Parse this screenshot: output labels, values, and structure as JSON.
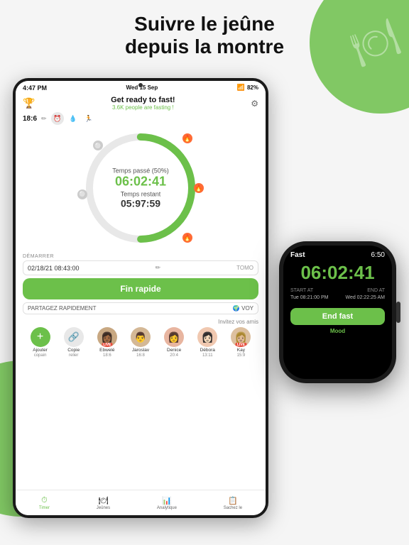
{
  "header": {
    "line1": "Suivre le jeûne",
    "line2": "depuis la montre"
  },
  "tablet": {
    "statusBar": {
      "time": "4:47 PM",
      "date": "Wed 15 Sep",
      "battery": "82%",
      "signal": "▲▼"
    },
    "appHeader": {
      "title": "Get ready to fast!",
      "subtitle": "3.6K people are fasting !",
      "trophy": "🏆",
      "gear": "⚙"
    },
    "fastSelector": {
      "label": "18:6",
      "edit": "✏",
      "icons": [
        "⏰",
        "💧",
        "🏃"
      ]
    },
    "timer": {
      "percentLabel": "Temps passé (50%)",
      "elapsedValue": "06:02:41",
      "remainingLabel": "Temps restant",
      "remainingValue": "05:97:59"
    },
    "startSection": {
      "label": "DÉMARRER",
      "dateValue": "02/18/21 08:43:00",
      "editIcon": "✏",
      "tomoLabel": "TOMO"
    },
    "finRapideBtn": "Fin rapide",
    "partagerRow": {
      "label": "PARTAGEZ RAPIDEMENT",
      "suffix": "🌍 VOY"
    },
    "friends": {
      "inviteLabel": "Invitez vos amis",
      "items": [
        {
          "name": "Ajouter copain",
          "avatar": "+",
          "time": "",
          "isAdd": true
        },
        {
          "name": "Copie relier",
          "avatar": "🔗",
          "time": "",
          "isLink": true
        },
        {
          "name": "Ebwelé 18:6",
          "avatar": "👩🏾",
          "time": "18:6",
          "live": true
        },
        {
          "name": "Jaroslav 16:8",
          "avatar": "👨",
          "time": "16:8",
          "live": false
        },
        {
          "name": "Denice 20:4",
          "avatar": "👩",
          "time": "20:4",
          "live": false
        },
        {
          "name": "Débora 13:11",
          "avatar": "👩🏻",
          "time": "13:11",
          "live": false
        },
        {
          "name": "Kay 15:9",
          "avatar": "👩🏼",
          "time": "15:9",
          "live": true
        }
      ]
    },
    "bottomNav": [
      {
        "label": "Timer",
        "icon": "⏱",
        "active": true
      },
      {
        "label": "Jeûnes",
        "icon": "🍴",
        "active": false
      },
      {
        "label": "Analytique",
        "icon": "📊",
        "active": false
      },
      {
        "label": "Sachez le",
        "icon": "📋",
        "active": false
      }
    ]
  },
  "watch": {
    "appName": "Fast",
    "time": "6:50",
    "timer": "06:02:41",
    "startAtLabel": "START AT",
    "startAtValue": "Tue 08:21:00 PM",
    "endAtLabel": "END AT",
    "endAtValue": "Wed 02:22:25 AM",
    "endFastBtn": "End fast",
    "moodLabel": "Mood"
  },
  "colors": {
    "green": "#6cc04a",
    "dark": "#1a1a1a",
    "orange": "#ff6b35"
  }
}
